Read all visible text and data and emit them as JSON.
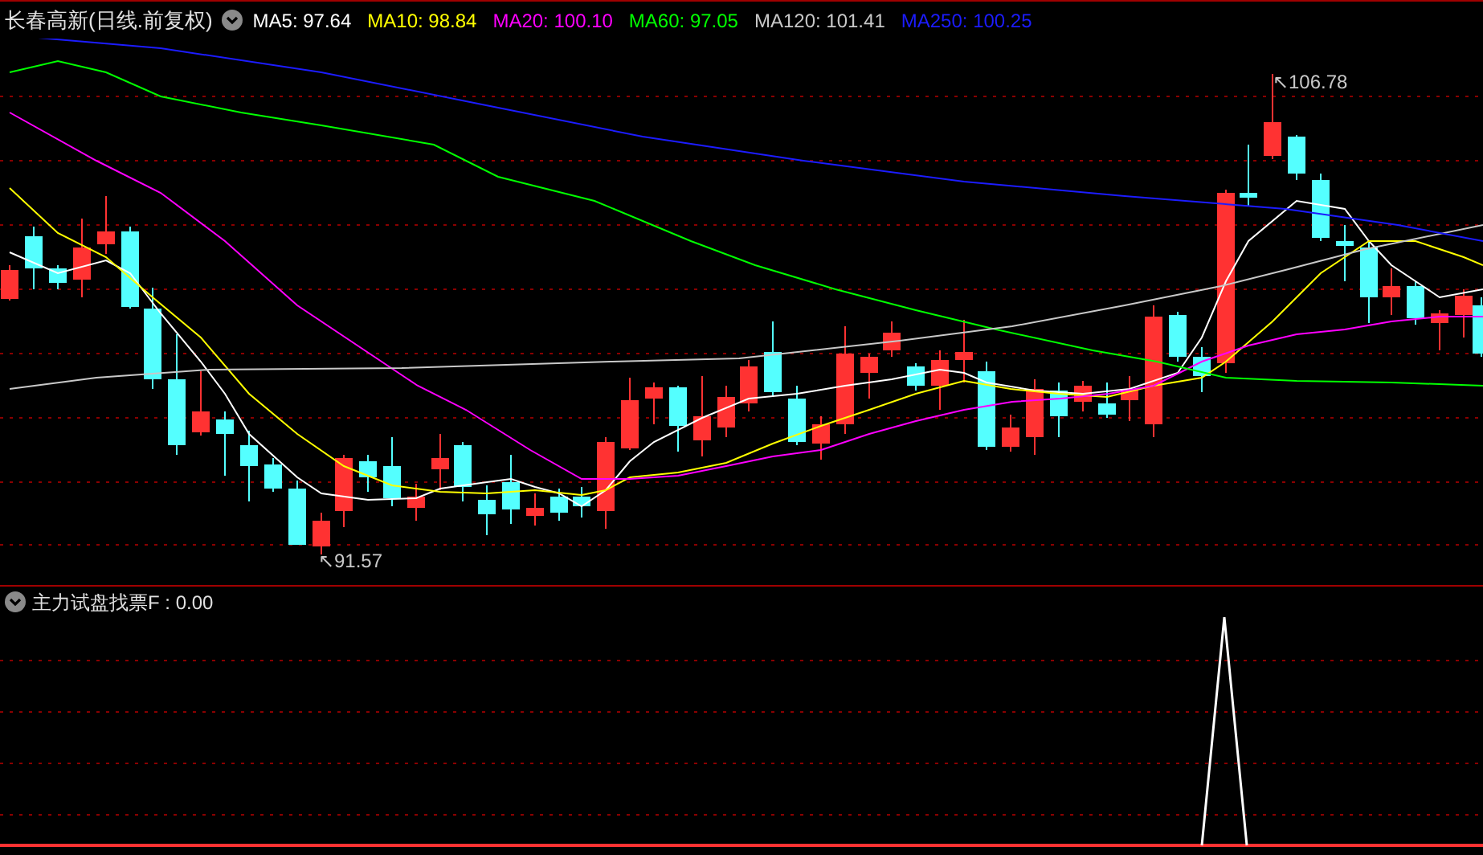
{
  "header": {
    "title": "长春高新(日线.前复权)",
    "ma_legend": [
      {
        "label": "MA5: 97.64",
        "color": "#ffffff"
      },
      {
        "label": "MA10: 98.84",
        "color": "#ffff00"
      },
      {
        "label": "MA20: 100.10",
        "color": "#ff00ff"
      },
      {
        "label": "MA60: 97.05",
        "color": "#00ff00"
      },
      {
        "label": "MA120: 101.41",
        "color": "#c8c8c8"
      },
      {
        "label": "MA250: 100.25",
        "color": "#1c1cff"
      }
    ]
  },
  "price_chart": {
    "high_marker": "↖106.78",
    "low_marker": "↖91.57"
  },
  "indicator_panel": {
    "label": "主力试盘找票F : 0.00"
  }
}
